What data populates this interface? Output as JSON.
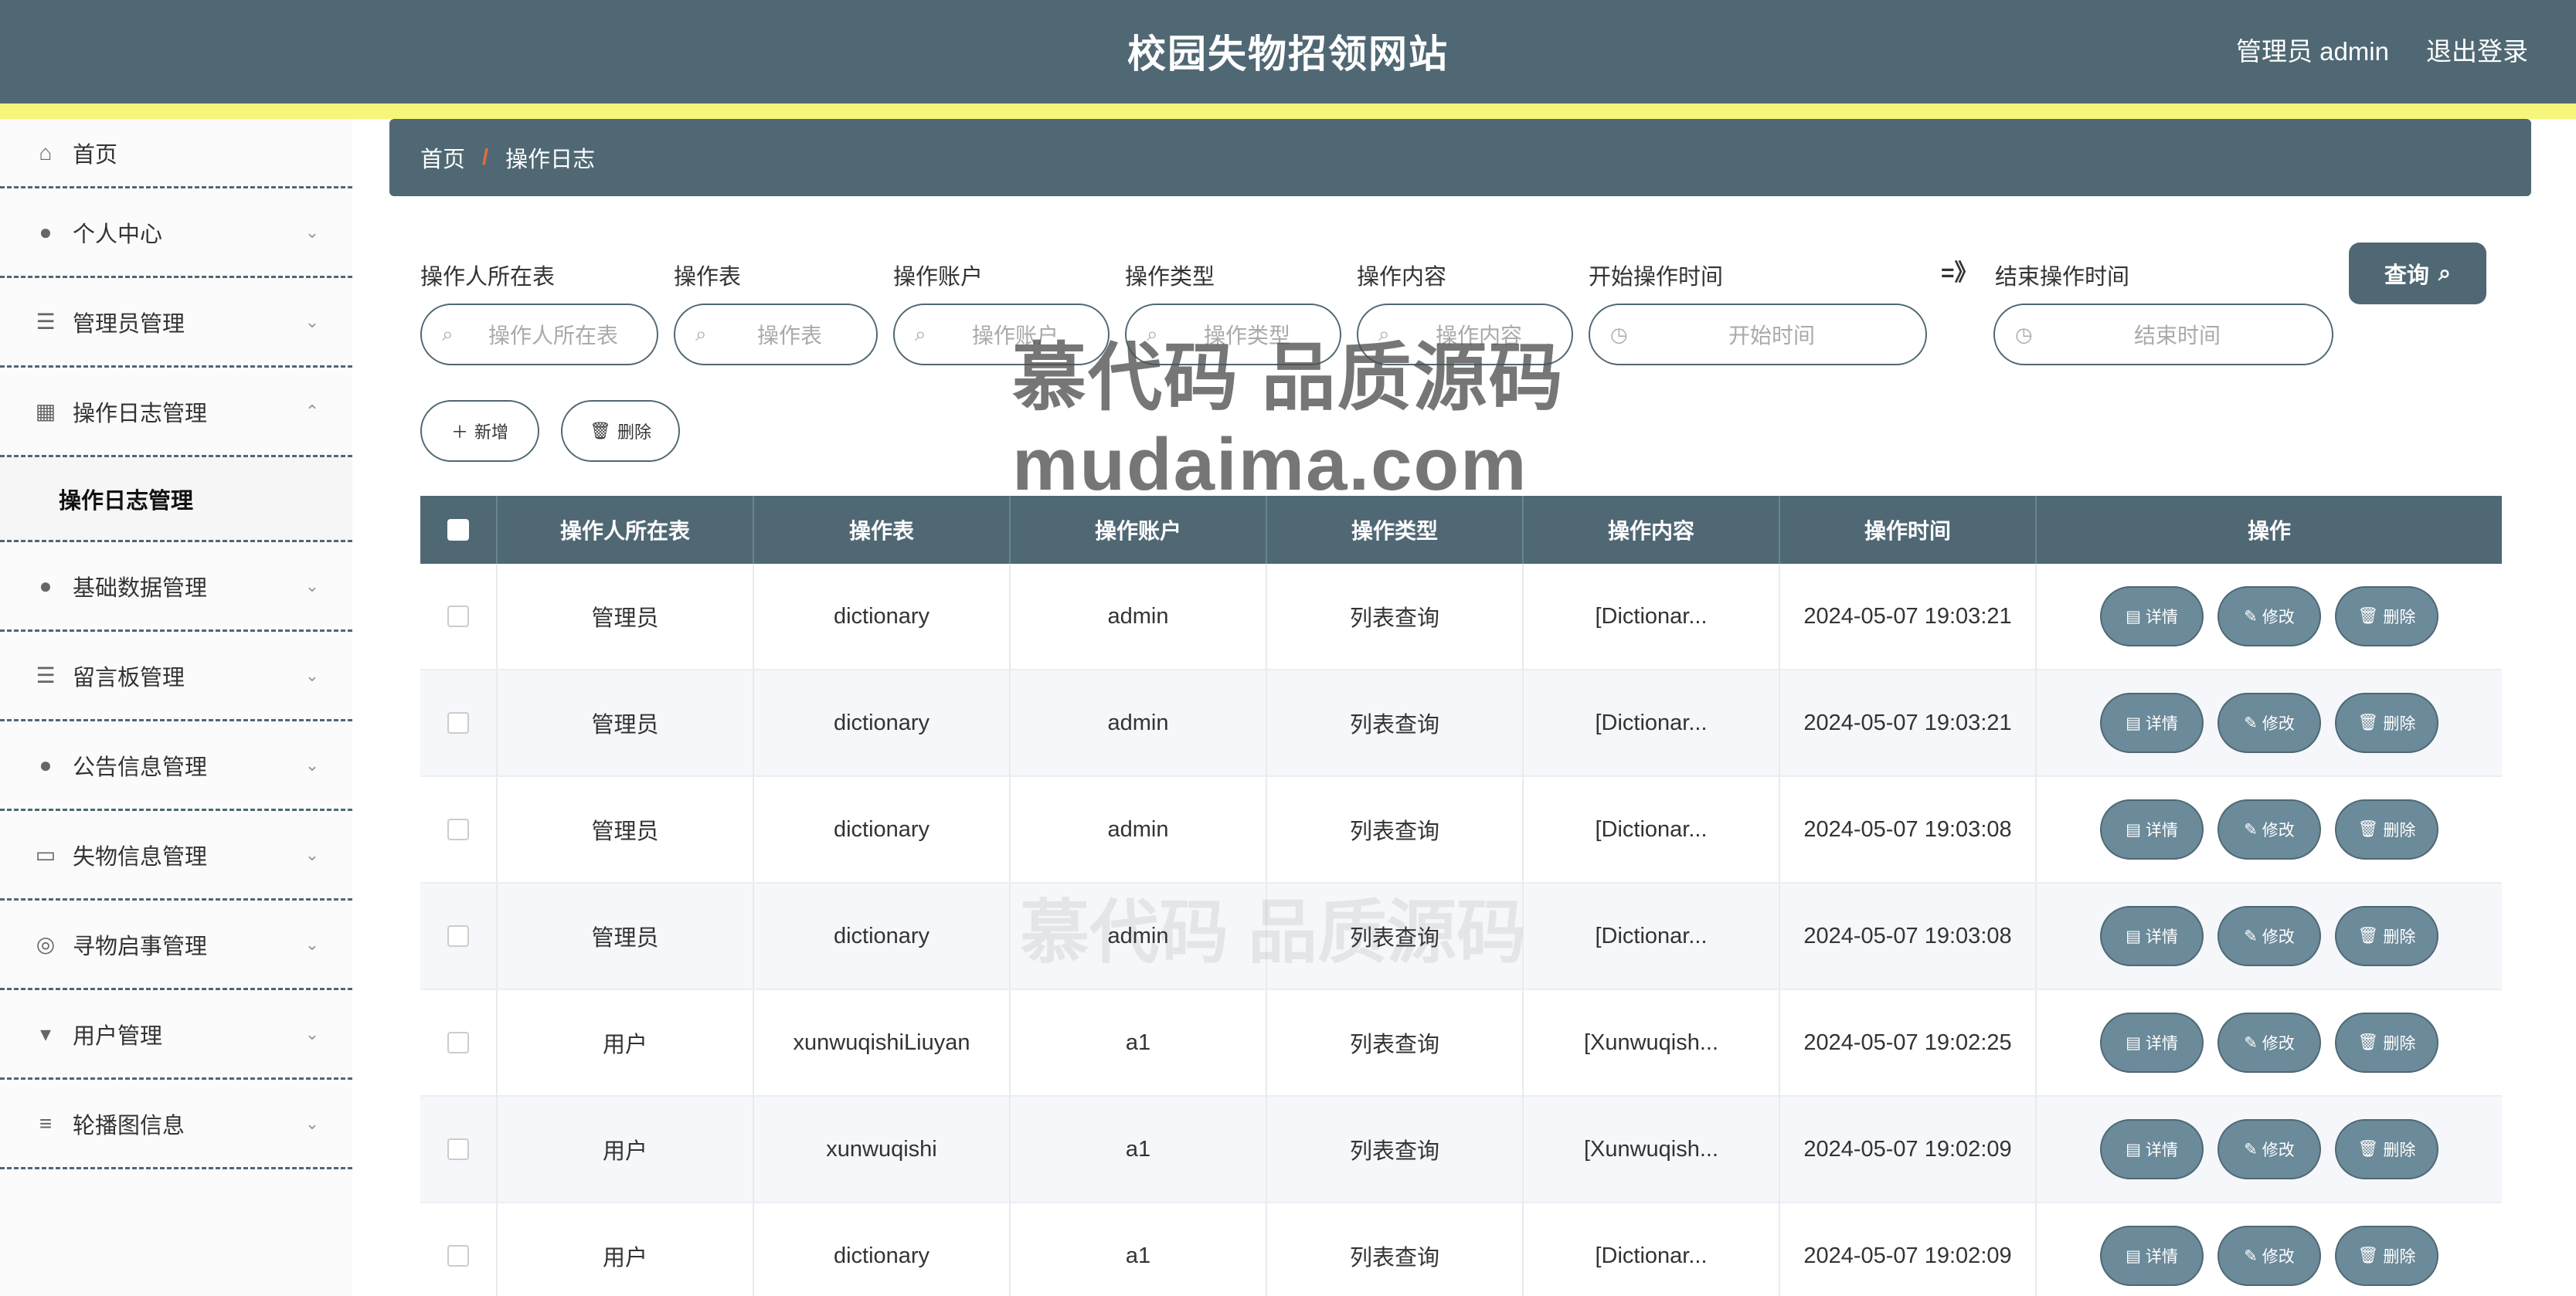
{
  "header": {
    "title": "校园失物招领网站",
    "user_label": "管理员 admin",
    "logout_label": "退出登录"
  },
  "sidebar": {
    "items": [
      {
        "label": "首页",
        "icon": "home-icon",
        "glyph": "⌂"
      },
      {
        "label": "个人中心",
        "icon": "user-icon",
        "glyph": "●"
      },
      {
        "label": "管理员管理",
        "icon": "list-icon",
        "glyph": "☰"
      },
      {
        "label": "操作日志管理",
        "icon": "grid-icon",
        "glyph": "▦"
      },
      {
        "label": "基础数据管理",
        "icon": "user-icon",
        "glyph": "●"
      },
      {
        "label": "留言板管理",
        "icon": "list-icon",
        "glyph": "☰"
      },
      {
        "label": "公告信息管理",
        "icon": "user-icon",
        "glyph": "●"
      },
      {
        "label": "失物信息管理",
        "icon": "card-icon",
        "glyph": "▭"
      },
      {
        "label": "寻物启事管理",
        "icon": "lifebuoy-icon",
        "glyph": "◎"
      },
      {
        "label": "用户管理",
        "icon": "pin-icon",
        "glyph": "▾"
      },
      {
        "label": "轮播图信息",
        "icon": "sliders-icon",
        "glyph": "≡"
      }
    ],
    "subitem": "操作日志管理"
  },
  "breadcrumb": {
    "home": "首页",
    "sep": "/",
    "current": "操作日志"
  },
  "filters": {
    "table_label": "操作人所在表",
    "table_placeholder": "操作人所在表",
    "op_table_label": "操作表",
    "op_table_placeholder": "操作表",
    "account_label": "操作账户",
    "account_placeholder": "操作账户",
    "type_label": "操作类型",
    "type_placeholder": "操作类型",
    "content_label": "操作内容",
    "content_placeholder": "操作内容",
    "start_label": "开始操作时间",
    "start_placeholder": "开始时间",
    "arrow": "=》",
    "end_label": "结束操作时间",
    "end_placeholder": "结束时间",
    "query_label": "查询"
  },
  "actions": {
    "add_label": "新增",
    "delete_label": "删除"
  },
  "table": {
    "headers": [
      "操作人所在表",
      "操作表",
      "操作账户",
      "操作类型",
      "操作内容",
      "操作时间",
      "操作"
    ],
    "op_labels": {
      "detail": "详情",
      "edit": "修改",
      "delete": "删除"
    },
    "rows": [
      [
        "管理员",
        "dictionary",
        "admin",
        "列表查询",
        "[Dictionar...",
        "2024-05-07 19:03:21"
      ],
      [
        "管理员",
        "dictionary",
        "admin",
        "列表查询",
        "[Dictionar...",
        "2024-05-07 19:03:21"
      ],
      [
        "管理员",
        "dictionary",
        "admin",
        "列表查询",
        "[Dictionar...",
        "2024-05-07 19:03:08"
      ],
      [
        "管理员",
        "dictionary",
        "admin",
        "列表查询",
        "[Dictionar...",
        "2024-05-07 19:03:08"
      ],
      [
        "用户",
        "xunwuqishiLiuyan",
        "a1",
        "列表查询",
        "[Xunwuqish...",
        "2024-05-07 19:02:25"
      ],
      [
        "用户",
        "xunwuqishi",
        "a1",
        "列表查询",
        "[Xunwuqish...",
        "2024-05-07 19:02:09"
      ],
      [
        "用户",
        "dictionary",
        "a1",
        "列表查询",
        "[Dictionar...",
        "2024-05-07 19:02:09"
      ]
    ]
  },
  "watermark": {
    "line1": "慕代码 品质源码",
    "line2": "mudaima.com"
  },
  "colors": {
    "primary": "#4f6874",
    "accent_stripe": "#f6f67a",
    "op_button": "#6b8a9a"
  }
}
